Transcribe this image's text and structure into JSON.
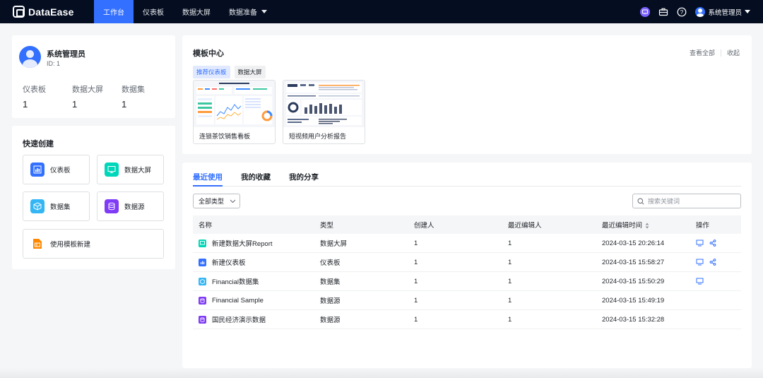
{
  "app": {
    "name": "DataEase"
  },
  "nav": [
    {
      "label": "工作台",
      "active": true
    },
    {
      "label": "仪表板",
      "active": false
    },
    {
      "label": "数据大屏",
      "active": false
    },
    {
      "label": "数据准备",
      "active": false,
      "dropdown": true
    }
  ],
  "topbar": {
    "user_name": "系统管理员",
    "icons": [
      "ai-assistant-icon",
      "toolbox-icon",
      "help-icon"
    ]
  },
  "profile": {
    "name": "系统管理员",
    "id_text": "ID:  1",
    "stats": [
      {
        "label": "仪表板",
        "value": "1"
      },
      {
        "label": "数据大屏",
        "value": "1"
      },
      {
        "label": "数据集",
        "value": "1"
      }
    ]
  },
  "quick_create": {
    "title": "快速创建",
    "items": [
      {
        "label": "仪表板",
        "icon": "dashboard-icon",
        "color": "#3370ff"
      },
      {
        "label": "数据大屏",
        "icon": "screen-icon",
        "color": "#00d6b9"
      },
      {
        "label": "数据集",
        "icon": "dataset-icon",
        "color": "#34b6f5"
      },
      {
        "label": "数据源",
        "icon": "datasource-icon",
        "color": "#7f3bf5"
      },
      {
        "label": "使用模板新建",
        "icon": "template-icon",
        "color": "#ff8800"
      }
    ]
  },
  "template_center": {
    "title": "模板中心",
    "view_all": "查看全部",
    "collapse": "收起",
    "chips": [
      {
        "label": "推荐仪表板",
        "active": true
      },
      {
        "label": "数据大屏",
        "active": false
      }
    ],
    "cards": [
      {
        "name": "连锁茶饮销售看板"
      },
      {
        "name": "短视频用户分析报告"
      }
    ]
  },
  "recent": {
    "tabs": [
      {
        "label": "最近使用",
        "active": true
      },
      {
        "label": "我的收藏",
        "active": false
      },
      {
        "label": "我的分享",
        "active": false
      }
    ],
    "filter_label": "全部类型",
    "search_placeholder": "搜索关键词",
    "columns": [
      "名称",
      "类型",
      "创建人",
      "最近编辑人",
      "最近编辑时间",
      "操作"
    ],
    "rows": [
      {
        "name": "新建数据大屏Report",
        "type": "数据大屏",
        "creator": "1",
        "editor": "1",
        "time": "2024-03-15  20:26:14",
        "icon": "screen-icon",
        "color": "#00d6b9",
        "share": true
      },
      {
        "name": "新建仪表板",
        "type": "仪表板",
        "creator": "1",
        "editor": "1",
        "time": "2024-03-15  15:58:27",
        "icon": "dashboard-icon",
        "color": "#3370ff",
        "share": true
      },
      {
        "name": "Financial数据集",
        "type": "数据集",
        "creator": "1",
        "editor": "1",
        "time": "2024-03-15  15:50:29",
        "icon": "dataset-icon",
        "color": "#34b6f5",
        "share": false
      },
      {
        "name": "Financial  Sample",
        "type": "数据源",
        "creator": "1",
        "editor": "1",
        "time": "2024-03-15  15:49:19",
        "icon": "datasource-icon",
        "color": "#7f3bf5",
        "share": false,
        "noactions": true
      },
      {
        "name": "国民经济演示数据",
        "type": "数据源",
        "creator": "1",
        "editor": "1",
        "time": "2024-03-15  15:32:28",
        "icon": "datasource-icon",
        "color": "#7f3bf5",
        "share": false,
        "noactions": true
      }
    ]
  }
}
